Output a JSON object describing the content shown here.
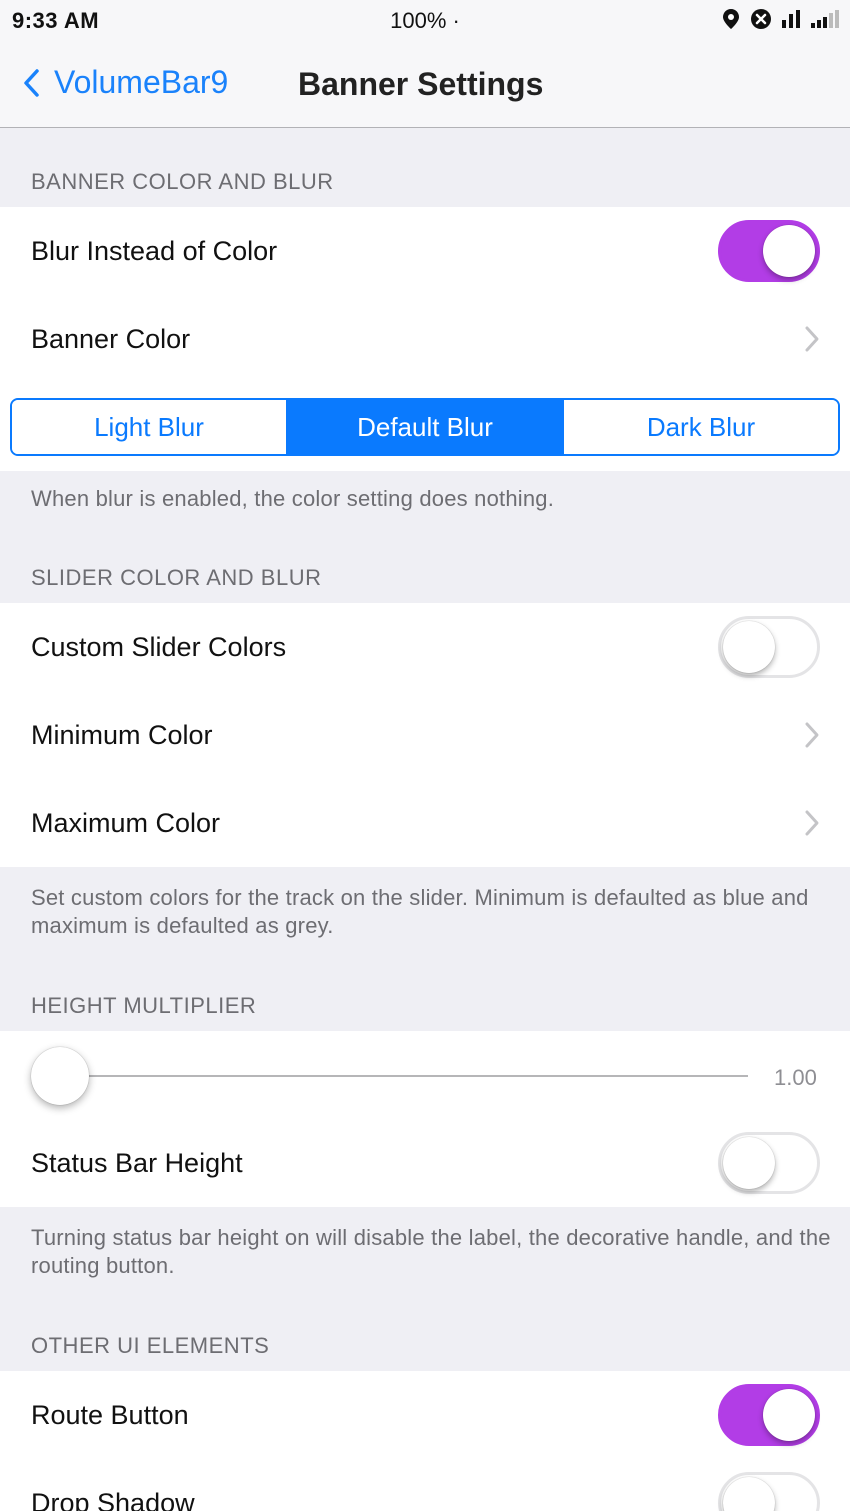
{
  "status_bar": {
    "time": "9:33 AM",
    "battery": "100% ·",
    "icons": [
      "location-icon",
      "close-circle-icon",
      "signal-bars-icon",
      "cellular-signal-icon"
    ]
  },
  "nav": {
    "back_label": "VolumeBar9",
    "title": "Banner Settings"
  },
  "colors": {
    "accent_blue": "#0a7afe",
    "toggle_on": "#b23de6",
    "background": "#efeff4"
  },
  "banner_section": {
    "header": "BANNER COLOR AND BLUR",
    "blur_instead_label": "Blur Instead of Color",
    "blur_instead_on": true,
    "banner_color_label": "Banner Color",
    "segments": [
      "Light Blur",
      "Default Blur",
      "Dark Blur"
    ],
    "selected_segment": "Default Blur",
    "footer": "When blur is enabled, the color setting does nothing."
  },
  "slider_section": {
    "header": "SLIDER COLOR AND BLUR",
    "custom_colors_label": "Custom Slider Colors",
    "custom_colors_on": false,
    "minimum_label": "Minimum Color",
    "maximum_label": "Maximum Color",
    "footer": "Set custom colors for the track on the slider. Minimum is defaulted as blue and maximum is defaulted as grey."
  },
  "height_section": {
    "header": "HEIGHT MULTIPLIER",
    "slider_value": "1.00",
    "status_bar_height_label": "Status Bar Height",
    "status_bar_height_on": false,
    "footer": "Turning status bar height on will disable the label, the decorative handle, and the routing button."
  },
  "other_section": {
    "header": "OTHER UI ELEMENTS",
    "route_button_label": "Route Button",
    "route_button_on": true,
    "drop_shadow_label": "Drop Shadow",
    "drop_shadow_on": false
  }
}
